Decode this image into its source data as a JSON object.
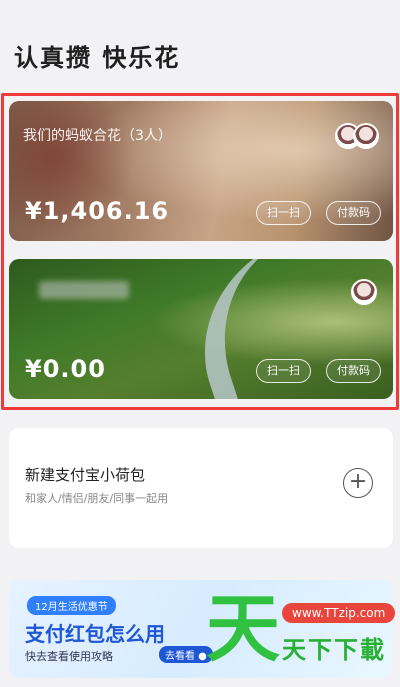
{
  "header": {
    "title": "认真攒 快乐花"
  },
  "cards": [
    {
      "name": "我们的蚂蚁合花（3人）",
      "subtitle": "",
      "amount": "¥1,406.16",
      "scan_label": "扫一扫",
      "pay_label": "付款码"
    },
    {
      "name": "",
      "amount": "¥0.00",
      "scan_label": "扫一扫",
      "pay_label": "付款码"
    }
  ],
  "new_wallet": {
    "title": "新建支付宝小荷包",
    "subtitle": "和家人/情侣/朋友/同事一起用",
    "add_symbol": "+"
  },
  "banner": {
    "tag": "12月生活优惠节",
    "title": "支付红包怎么用",
    "subtitle": "快去查看使用攻略",
    "cta": "去看看 ●"
  },
  "watermark": {
    "glyph": "天",
    "url": "www.TTzip.com",
    "text": "天下下載"
  },
  "colors": {
    "highlight": "#ef3a3a",
    "brand_blue": "#1f56d6",
    "watermark_green": "#2fc13f"
  }
}
